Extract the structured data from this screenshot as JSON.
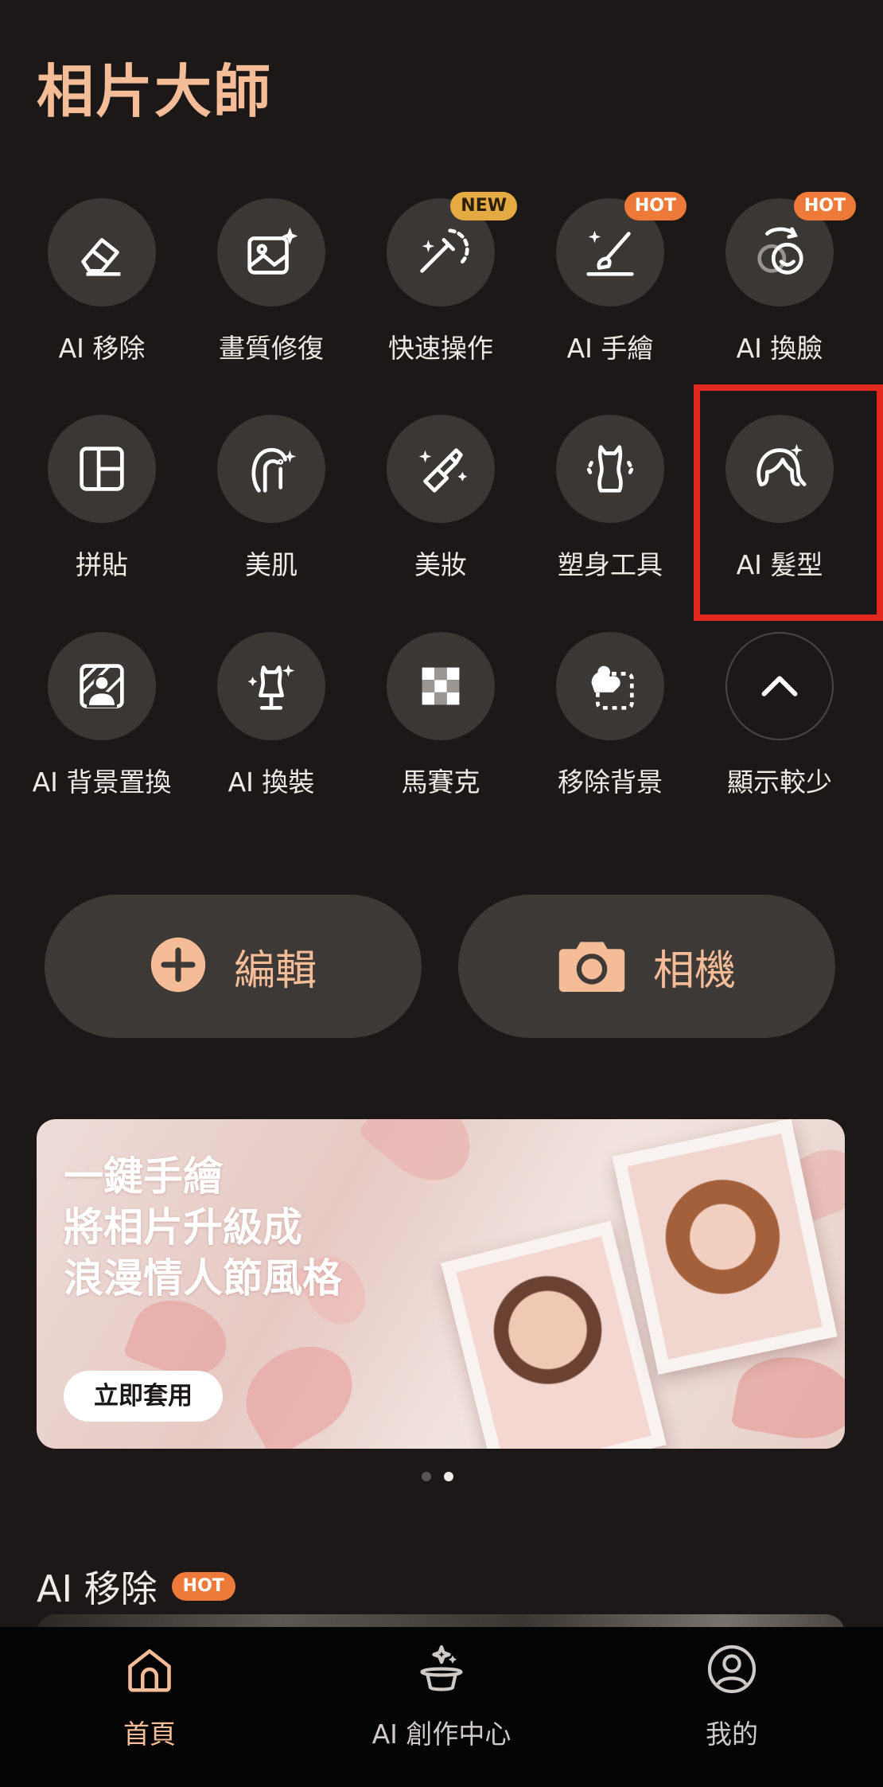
{
  "app_title": "相片大師",
  "tools": [
    {
      "label": "AI 移除",
      "icon": "eraser-icon"
    },
    {
      "label": "畫質修復",
      "icon": "image-enhance-icon"
    },
    {
      "label": "快速操作",
      "icon": "magic-wand-icon",
      "badge": "NEW"
    },
    {
      "label": "AI 手繪",
      "icon": "paintbrush-icon",
      "badge": "HOT"
    },
    {
      "label": "AI 換臉",
      "icon": "face-swap-icon",
      "badge": "HOT"
    },
    {
      "label": "拼貼",
      "icon": "collage-icon"
    },
    {
      "label": "美肌",
      "icon": "skin-face-icon"
    },
    {
      "label": "美妝",
      "icon": "lipstick-icon"
    },
    {
      "label": "塑身工具",
      "icon": "body-shape-icon"
    },
    {
      "label": "AI 髮型",
      "icon": "hairstyle-icon"
    },
    {
      "label": "AI 背景置換",
      "icon": "background-replace-icon"
    },
    {
      "label": "AI 換裝",
      "icon": "mannequin-icon"
    },
    {
      "label": "馬賽克",
      "icon": "mosaic-icon"
    },
    {
      "label": "移除背景",
      "icon": "remove-background-icon"
    },
    {
      "label": "顯示較少",
      "icon": "chevron-up-icon"
    }
  ],
  "actions": {
    "edit_label": "編輯",
    "camera_label": "相機"
  },
  "banner": {
    "line1": "一鍵手繪",
    "line2": "將相片升級成",
    "line3": "浪漫情人節風格",
    "button": "立即套用"
  },
  "section": {
    "title": "AI 移除",
    "badge": "HOT"
  },
  "tabs": [
    {
      "label": "首頁",
      "icon": "home-icon"
    },
    {
      "label": "AI 創作中心",
      "icon": "ai-magic-hat-icon"
    },
    {
      "label": "我的",
      "icon": "profile-icon"
    }
  ],
  "colors": {
    "accent": "#f4bd98",
    "background": "#1b1817",
    "tile": "#3b3735",
    "hot": "#ee7a3a",
    "new": "#e6aa43",
    "highlight": "#e3281e"
  }
}
